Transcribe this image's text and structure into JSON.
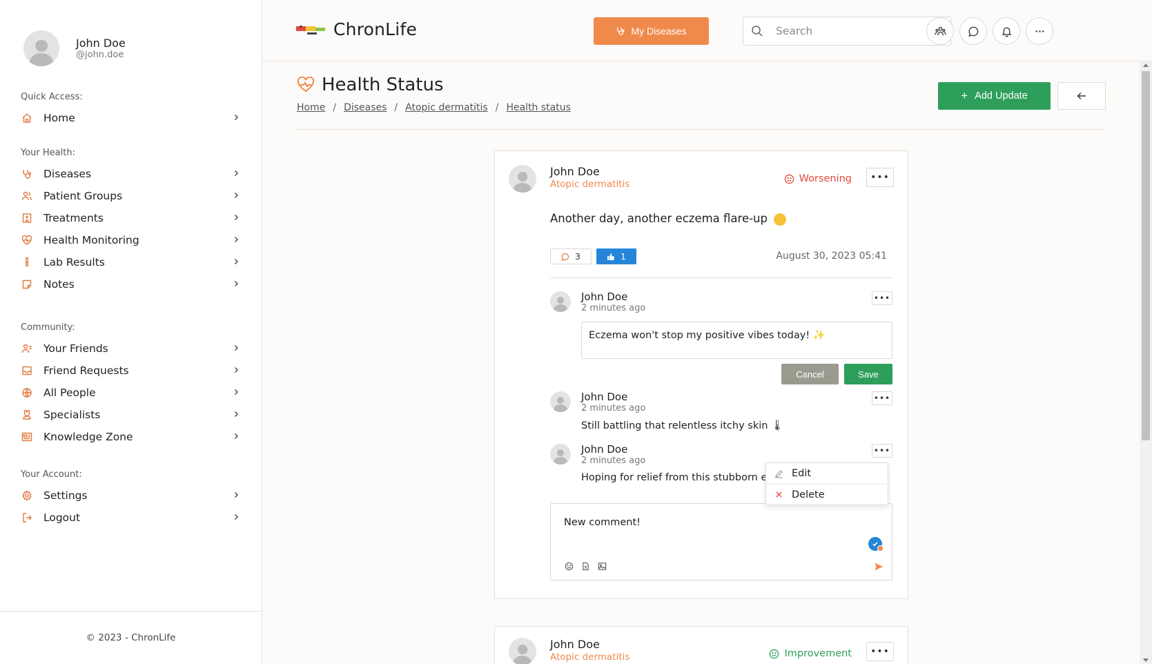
{
  "user": {
    "name": "John Doe",
    "handle": "@john.doe"
  },
  "sidebar": {
    "sections": [
      {
        "heading": "Quick Access:",
        "items": [
          {
            "label": "Home",
            "icon": "home-icon"
          }
        ]
      },
      {
        "heading": "Your Health:",
        "items": [
          {
            "label": "Diseases",
            "icon": "stethoscope-icon"
          },
          {
            "label": "Patient Groups",
            "icon": "users-icon"
          },
          {
            "label": "Treatments",
            "icon": "hospital-icon"
          },
          {
            "label": "Health Monitoring",
            "icon": "heart-pulse-icon"
          },
          {
            "label": "Lab Results",
            "icon": "test-tube-icon"
          },
          {
            "label": "Notes",
            "icon": "note-icon"
          }
        ]
      },
      {
        "heading": "Community:",
        "items": [
          {
            "label": "Your Friends",
            "icon": "user-friends-icon"
          },
          {
            "label": "Friend Requests",
            "icon": "inbox-icon"
          },
          {
            "label": "All People",
            "icon": "globe-icon"
          },
          {
            "label": "Specialists",
            "icon": "doctor-icon"
          },
          {
            "label": "Knowledge Zone",
            "icon": "newspaper-icon"
          }
        ]
      },
      {
        "heading": "Your Account:",
        "items": [
          {
            "label": "Settings",
            "icon": "gear-icon"
          },
          {
            "label": "Logout",
            "icon": "logout-icon"
          }
        ]
      }
    ],
    "footer": "© 2023 - ChronLife"
  },
  "header": {
    "brand": "ChronLife",
    "my_diseases": "My Diseases",
    "search_placeholder": "Search"
  },
  "page": {
    "title": "Health Status",
    "breadcrumb": [
      "Home",
      "Diseases",
      "Atopic dermatitis",
      "Health status"
    ],
    "add_update": "Add Update"
  },
  "posts": [
    {
      "author": "John Doe",
      "disease": "Atopic dermatitis",
      "status": "Worsening",
      "text": "Another day, another eczema flare-up",
      "comment_count": "3",
      "like_count": "1",
      "date": "August 30, 2023 05:41",
      "comments": [
        {
          "author": "John Doe",
          "time": "2 minutes ago",
          "edit_text": "Eczema won't stop my positive vibes today! ✨",
          "cancel": "Cancel",
          "save": "Save"
        },
        {
          "author": "John Doe",
          "time": "2 minutes ago",
          "text": "Still battling that relentless itchy skin 🌡"
        },
        {
          "author": "John Doe",
          "time": "2 minutes ago",
          "text": "Hoping for relief from this stubborn ecz"
        }
      ],
      "menu": [
        "Edit",
        "Delete"
      ],
      "new_comment": "New comment!"
    },
    {
      "author": "John Doe",
      "disease": "Atopic dermatitis",
      "status": "Improvement"
    }
  ],
  "colors": {
    "accent": "#f08a4b",
    "green": "#2d9f5b",
    "red": "#e04a3c",
    "blue": "#2585d8"
  }
}
